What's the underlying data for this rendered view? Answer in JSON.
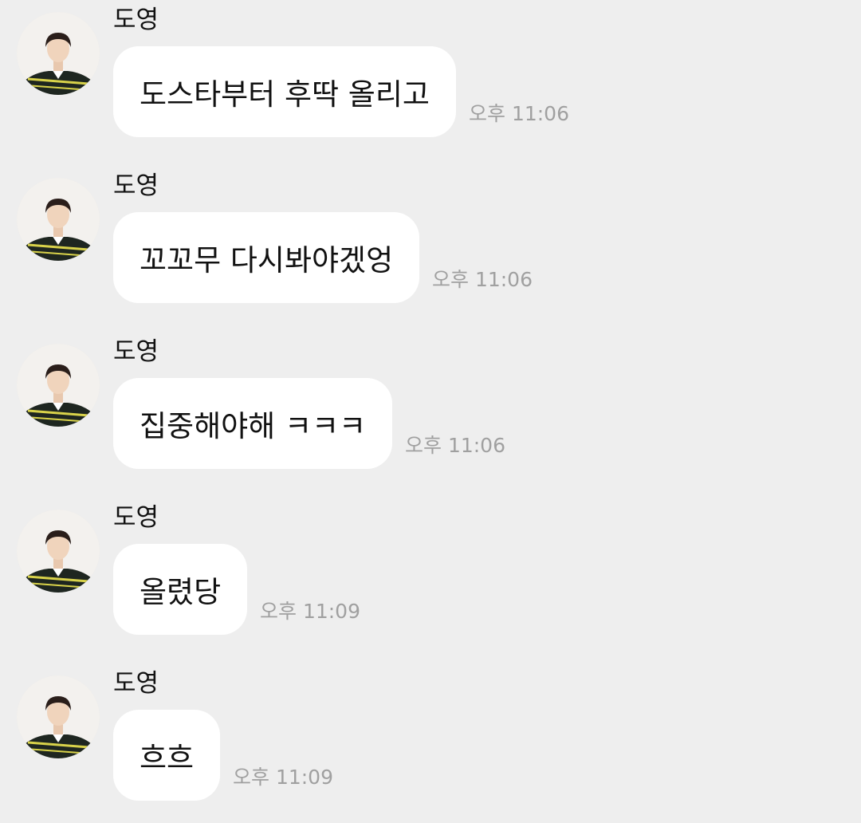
{
  "messages": [
    {
      "sender": "도영",
      "text": "도스타부터 후딱 올리고",
      "time": "오후 11:06"
    },
    {
      "sender": "도영",
      "text": "꼬꼬무 다시봐야겠엉",
      "time": "오후 11:06"
    },
    {
      "sender": "도영",
      "text": "집중해야해 ㅋㅋㅋ",
      "time": "오후 11:06"
    },
    {
      "sender": "도영",
      "text": "올렸당",
      "time": "오후 11:09"
    },
    {
      "sender": "도영",
      "text": "흐흐",
      "time": "오후 11:09"
    }
  ]
}
